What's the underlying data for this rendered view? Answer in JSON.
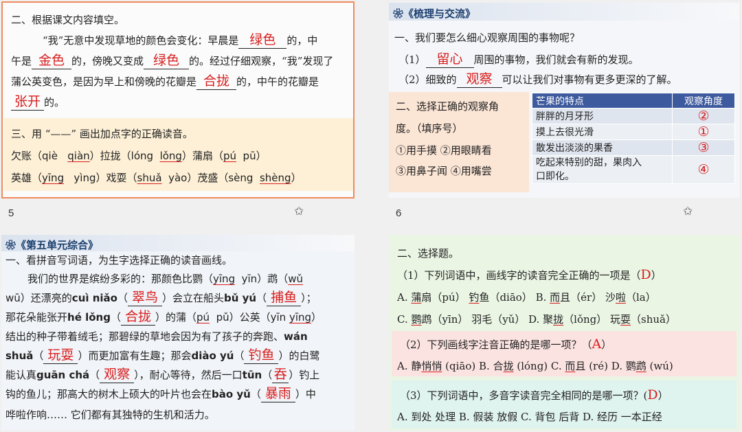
{
  "slide5": {
    "page_number": "5",
    "q2_title": "二、根据课文内容填空。",
    "p1": [
      "“我”无意中发现草地的颜色会变化：早晨是",
      "绿色",
      "的，中"
    ],
    "p2": [
      "午是",
      "金色",
      "的，傍晚又变成",
      "绿色",
      "的。经过仔细观察，“我”发现了"
    ],
    "p3": [
      "蒲公英变色，是因为早上和傍晚的花瓣是",
      "合拢",
      "的，中午的花瓣是"
    ],
    "p4": [
      "张开",
      "的。"
    ],
    "q3_title": "三、用 “——” 画出加点字的正确读音。",
    "r1": [
      "欠账（",
      "qiè",
      "qiàn",
      "）拉拢（",
      "lóng",
      "lǒng",
      "）蒲扇（",
      "pú",
      "pū",
      "）"
    ],
    "r2": [
      "英雄（",
      "yīng",
      "yìng",
      "）戏耍（",
      "shuǎ",
      "yào",
      "）茂盛（",
      "sèng",
      "shèng",
      "）"
    ]
  },
  "slide6": {
    "page_number": "6",
    "header": "《梳理与交流》",
    "q1": "一、我们要怎么细心观察周围的事物呢？",
    "l1": [
      "（1）",
      "留心",
      "周围的事物，我们就会有新的发现。"
    ],
    "l2": [
      "（2）细致的",
      "观察",
      "可以让我们对事物有更多更深的了解。"
    ],
    "q2_lines": [
      "二、选择正确的观察角",
      "度。（填序号）",
      "①用手摸 ②用眼睛看",
      "③用鼻子闻 ④用嘴尝"
    ],
    "table_header": [
      "芒果的特点",
      "观察角度"
    ],
    "table_rows": [
      [
        "胖胖的月牙形",
        "②"
      ],
      [
        "摸上去很光滑",
        "①"
      ],
      [
        "散发出淡淡的果香",
        "③"
      ],
      [
        "吃起来特别的甜，果肉入",
        "④"
      ]
    ],
    "table_row4_line2": "口即化。"
  },
  "slide7": {
    "header": "《第五单元综合》",
    "title": "一、看拼音写词语，为生字选择正确的读音画线。",
    "t1": [
      "我们的世界是缤纷多彩的：那颜色比鹦（",
      "yīng",
      "yīn",
      "）鹉（",
      "wǔ"
    ],
    "t2": [
      "wū",
      "）还漂亮的",
      "cuì niǎo",
      "（",
      "翠鸟",
      "）会立在船头",
      "bǔ yú",
      "（",
      "捕鱼",
      "）；"
    ],
    "t3": [
      "那花朵能张开",
      "hé lǒng",
      "（",
      "合拢",
      "）的蒲（",
      "pú",
      "pǔ",
      "）公英（",
      "yīn",
      "yīng",
      "）"
    ],
    "t4": [
      "结出的种子带着绒毛；那碧绿的草地会因为有了孩子的奔跑、",
      "wán"
    ],
    "t5": [
      "shuǎ",
      "（",
      "玩耍",
      "）而更加富有生趣；那会",
      "diào yú",
      "（",
      "钓鱼",
      "）的白鹭"
    ],
    "t6": [
      "能认真",
      "guān chá",
      "（",
      "观察",
      "），耐心等待，然后一口",
      "tūn",
      "（",
      "吞",
      "）钓上"
    ],
    "t7": [
      "钩的鱼儿；那高大的树木上硕大的叶片也会在",
      "bào yǔ",
      "（",
      "暴雨",
      "）中"
    ],
    "t8": "哗啦作响…… 它们都有其独特的生机和活力。"
  },
  "slide8": {
    "title": "二、选择题。",
    "q1": [
      "（1）下列词语中，画线字的读音完全正确的一项是（",
      "D",
      "）"
    ],
    "q1a": [
      "A. ",
      "蒲",
      "扇（pú） ",
      "钓",
      "鱼（diāo） B. ",
      "而",
      "且（ér） 沙",
      "啦",
      "（la）"
    ],
    "q1b": [
      "C. ",
      "鹦",
      "鹉（yīn） 羽毛（yǔ）  D. 聚",
      "拢",
      "（lǒng） 玩",
      "耍",
      "（shuǎ）"
    ],
    "q2": [
      "（2）下列画线字注音正确的是哪一项？（",
      "A",
      "）"
    ],
    "q2a": [
      "A. 静",
      "悄悄",
      " (qiāo) B. 合",
      "拢",
      " (lóng) C. ",
      "而",
      "且 (ré) D. 鹦",
      "鹉",
      " (wú)"
    ],
    "q3": [
      "（3）下列词语中，多音字读音完全相同的是哪一项？(",
      "D",
      "）"
    ],
    "q3a": "A. 到处 处理 B. 假装 放假 C. 背包 后背 D. 经历 一本正经"
  },
  "colors": {
    "answer_red": "#d81e1e",
    "header_blue": "#3d5a9e",
    "selected_border": "#f08a5d"
  }
}
